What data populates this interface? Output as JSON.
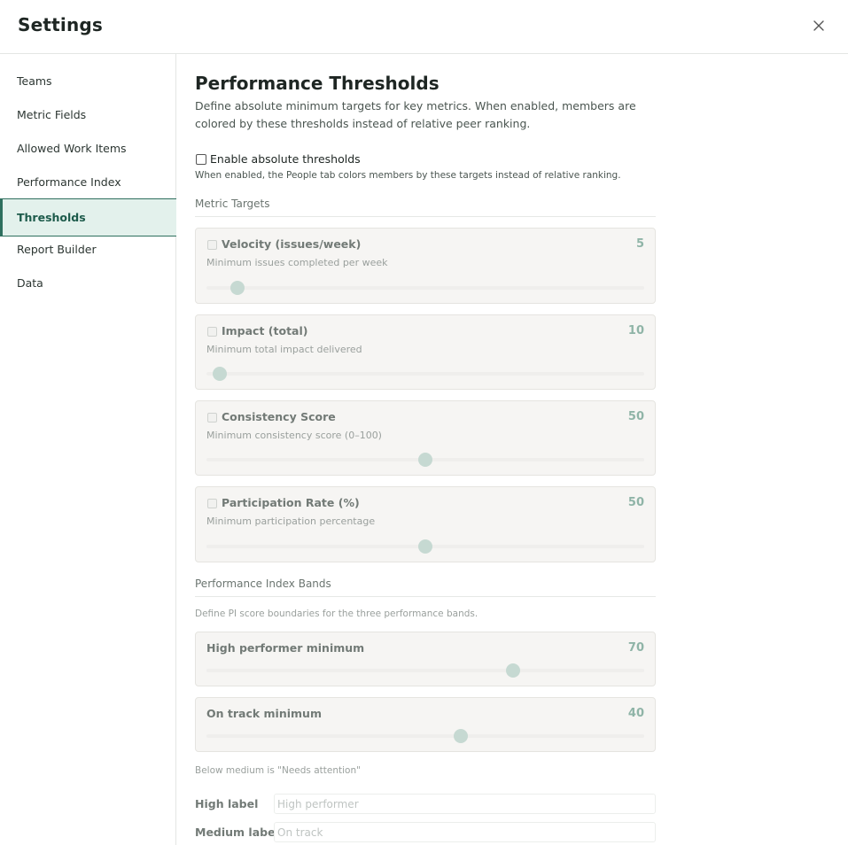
{
  "header": {
    "title": "Settings"
  },
  "sidebar": {
    "items": [
      {
        "label": "Teams"
      },
      {
        "label": "Metric Fields"
      },
      {
        "label": "Allowed Work Items"
      },
      {
        "label": "Performance Index"
      },
      {
        "label": "Thresholds",
        "active": true
      },
      {
        "label": "Report Builder"
      },
      {
        "label": "Data"
      }
    ]
  },
  "main": {
    "title": "Performance Thresholds",
    "description": "Define absolute minimum targets for key metrics. When enabled, members are colored by these thresholds instead of relative peer ranking.",
    "enable": {
      "label": "Enable absolute thresholds",
      "checked": false,
      "help": "When enabled, the People tab colors members by these targets instead of relative ranking."
    },
    "metric_targets": {
      "title": "Metric Targets",
      "items": [
        {
          "name": "Velocity (issues/week)",
          "value": "5",
          "help": "Minimum issues completed per week",
          "slider_fraction": 0.07
        },
        {
          "name": "Impact (total)",
          "value": "10",
          "help": "Minimum total impact delivered",
          "slider_fraction": 0.03
        },
        {
          "name": "Consistency Score",
          "value": "50",
          "help": "Minimum consistency score (0–100)",
          "slider_fraction": 0.5
        },
        {
          "name": "Participation Rate (%)",
          "value": "50",
          "help": "Minimum participation percentage",
          "slider_fraction": 0.5
        }
      ]
    },
    "bands": {
      "title": "Performance Index Bands",
      "help": "Define PI score boundaries for the three performance bands.",
      "items": [
        {
          "name": "High performer minimum",
          "value": "70",
          "slider_fraction": 0.7
        },
        {
          "name": "On track minimum",
          "value": "40",
          "slider_fraction": 0.58
        }
      ],
      "note": "Below medium is \"Needs attention\""
    },
    "labels": {
      "high_label": "High label",
      "high_placeholder": "High performer",
      "medium_label": "Medium label",
      "medium_placeholder": "On track"
    }
  },
  "colors": {
    "accent": "#2e6f5e",
    "active_bg": "#e3f1ec",
    "value": "#8fb4a7",
    "thumb": "#c6d9d2"
  }
}
